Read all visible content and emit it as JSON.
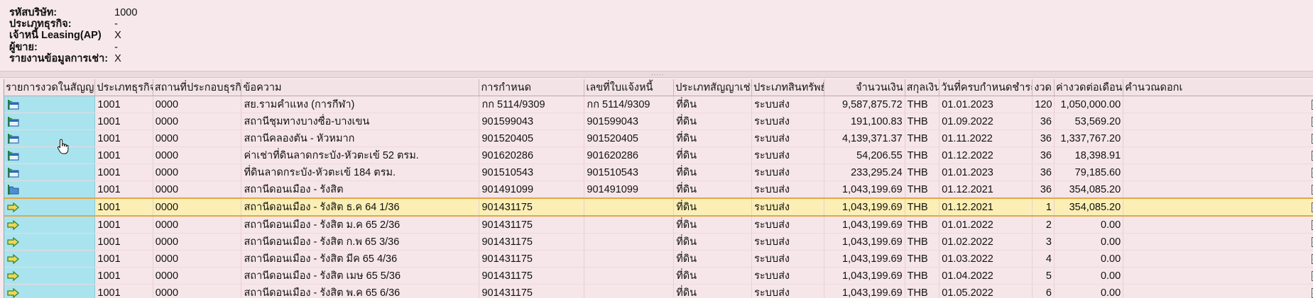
{
  "header": {
    "fields": [
      {
        "label": "รหัสบริษัท:",
        "value": "1000"
      },
      {
        "label": "ประเภทธุรกิจ:",
        "value": "-"
      },
      {
        "label": "เจ้าหนี้ Leasing(AP)",
        "value": "X"
      },
      {
        "label": "ผู้ขาย:",
        "value": "-"
      },
      {
        "label": "รายงานข้อมูลการเช่า:",
        "value": "X"
      }
    ]
  },
  "splitter": {
    "grip": "·····"
  },
  "grid": {
    "columns": [
      "รายการงวดในสัญญา",
      "ประเภทธุรกิจ",
      "สถานที่ประกอบธุรกิจ",
      "ข้อความ",
      "การกำหนด",
      "เลขที่ใบแจ้งหนี้",
      "ประเภทสัญญาเช่า",
      "ประเภทสินทรัพย์",
      "จำนวนเงิน",
      "สกุลเงิน",
      "วันที่ครบกำหนดชำระ",
      "งวด",
      "ค่างวดต่อเดือน",
      "คำนวณดอกเ"
    ],
    "rows": [
      {
        "icon": "folder-flag",
        "bt": "1001",
        "loc": "0000",
        "text": "สย.รามคำแหง (การกีฬา)",
        "assign": "กก 5114/9309",
        "invoice": "กก 5114/9309",
        "lease_type": "ที่ดิน",
        "asset_type": "ระบบส่ง",
        "amount": "9,587,875.72",
        "currency": "THB",
        "due": "01.01.2023",
        "period": "120",
        "monthly": "1,050,000.00",
        "calc": true
      },
      {
        "icon": "folder-flag",
        "bt": "1001",
        "loc": "0000",
        "text": "สถานีชุมทางบางซื่อ-บางเขน",
        "assign": "901599043",
        "invoice": "901599043",
        "lease_type": "ที่ดิน",
        "asset_type": "ระบบส่ง",
        "amount": "191,100.83",
        "currency": "THB",
        "due": "01.09.2022",
        "period": "36",
        "monthly": "53,569.20",
        "calc": true
      },
      {
        "icon": "folder-flag",
        "bt": "1001",
        "loc": "0000",
        "text": "สถานีคลองตัน - หัวหมาก",
        "assign": "901520405",
        "invoice": "901520405",
        "lease_type": "ที่ดิน",
        "asset_type": "ระบบส่ง",
        "amount": "4,139,371.37",
        "currency": "THB",
        "due": "01.11.2022",
        "period": "36",
        "monthly": "1,337,767.20",
        "calc": true
      },
      {
        "icon": "folder-flag",
        "bt": "1001",
        "loc": "0000",
        "text": "ค่าเช่าที่ดินลาดกระบัง-หัวตะเข้ 52 ตรม.",
        "assign": "901620286",
        "invoice": "901620286",
        "lease_type": "ที่ดิน",
        "asset_type": "ระบบส่ง",
        "amount": "54,206.55",
        "currency": "THB",
        "due": "01.12.2022",
        "period": "36",
        "monthly": "18,398.91",
        "calc": true
      },
      {
        "icon": "folder-flag",
        "bt": "1001",
        "loc": "0000",
        "text": "ที่ดินลาดกระบัง-หัวตะเข้ 184 ตรม.",
        "assign": "901510543",
        "invoice": "901510543",
        "lease_type": "ที่ดิน",
        "asset_type": "ระบบส่ง",
        "amount": "233,295.24",
        "currency": "THB",
        "due": "01.01.2023",
        "period": "36",
        "monthly": "79,185.60",
        "calc": true
      },
      {
        "icon": "folder-open",
        "bt": "1001",
        "loc": "0000",
        "text": "สถานีดอนเมือง - รังสิต",
        "assign": "901491099",
        "invoice": "901491099",
        "lease_type": "ที่ดิน",
        "asset_type": "ระบบส่ง",
        "amount": "1,043,199.69",
        "currency": "THB",
        "due": "01.12.2021",
        "period": "36",
        "monthly": "354,085.20",
        "calc": true
      },
      {
        "icon": "arrow-item",
        "bt": "1001",
        "loc": "0000",
        "text": "สถานีดอนเมือง - รังสิต ธ.ค 64 1/36",
        "assign": "901431175",
        "invoice": "",
        "lease_type": "ที่ดิน",
        "asset_type": "ระบบส่ง",
        "amount": "1,043,199.69",
        "currency": "THB",
        "due": "01.12.2021",
        "period": "1",
        "monthly": "354,085.20",
        "calc": true,
        "highlight": true
      },
      {
        "icon": "arrow-item",
        "bt": "1001",
        "loc": "0000",
        "text": "สถานีดอนเมือง - รังสิต ม.ค 65 2/36",
        "assign": "901431175",
        "invoice": "",
        "lease_type": "ที่ดิน",
        "asset_type": "ระบบส่ง",
        "amount": "1,043,199.69",
        "currency": "THB",
        "due": "01.01.2022",
        "period": "2",
        "monthly": "0.00",
        "calc": true
      },
      {
        "icon": "arrow-item",
        "bt": "1001",
        "loc": "0000",
        "text": "สถานีดอนเมือง - รังสิต ก.พ 65 3/36",
        "assign": "901431175",
        "invoice": "",
        "lease_type": "ที่ดิน",
        "asset_type": "ระบบส่ง",
        "amount": "1,043,199.69",
        "currency": "THB",
        "due": "01.02.2022",
        "period": "3",
        "monthly": "0.00",
        "calc": true
      },
      {
        "icon": "arrow-item",
        "bt": "1001",
        "loc": "0000",
        "text": "สถานีดอนเมือง - รังสิต มีค 65 4/36",
        "assign": "901431175",
        "invoice": "",
        "lease_type": "ที่ดิน",
        "asset_type": "ระบบส่ง",
        "amount": "1,043,199.69",
        "currency": "THB",
        "due": "01.03.2022",
        "period": "4",
        "monthly": "0.00",
        "calc": true
      },
      {
        "icon": "arrow-item",
        "bt": "1001",
        "loc": "0000",
        "text": "สถานีดอนเมือง - รังสิต เมษ 65 5/36",
        "assign": "901431175",
        "invoice": "",
        "lease_type": "ที่ดิน",
        "asset_type": "ระบบส่ง",
        "amount": "1,043,199.69",
        "currency": "THB",
        "due": "01.04.2022",
        "period": "5",
        "monthly": "0.00",
        "calc": true
      },
      {
        "icon": "arrow-item",
        "bt": "1001",
        "loc": "0000",
        "text": "สถานีดอนเมือง - รังสิต พ.ค 65 6/36",
        "assign": "901431175",
        "invoice": "",
        "lease_type": "ที่ดิน",
        "asset_type": "ระบบส่ง",
        "amount": "1,043,199.69",
        "currency": "THB",
        "due": "01.05.2022",
        "period": "6",
        "monthly": "0.00",
        "calc": true
      }
    ]
  },
  "colors": {
    "selection_column": "#a9e3ee",
    "highlight_row": "#fbefb5",
    "highlight_border": "#e0a84a",
    "background": "#f7e9ec"
  },
  "pointer": {
    "icon": "hand-pointer-icon"
  }
}
